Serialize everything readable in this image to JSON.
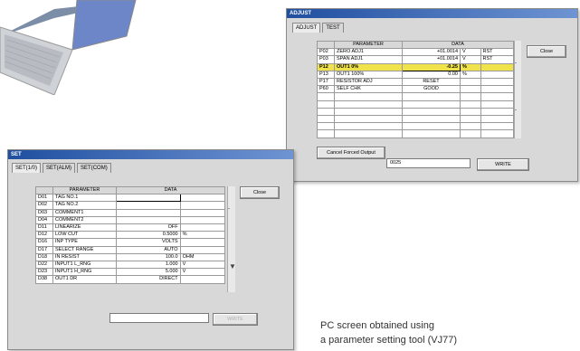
{
  "adjust_window": {
    "title": "ADJUST",
    "tabs": [
      "ADJUST",
      "TEST"
    ],
    "columns": [
      "PARAMETER",
      "DATA"
    ],
    "rows": [
      {
        "code": "P02",
        "name": "ZERO ADJ1",
        "data": "+01.0014",
        "unit": "V",
        "extra": "RST"
      },
      {
        "code": "P03",
        "name": "SPAN ADJ1",
        "data": "+01.0014",
        "unit": "V",
        "extra": "RST"
      },
      {
        "code": "P12",
        "name": "OUT1 0%",
        "data": "-0.25",
        "unit": "%",
        "extra": ""
      },
      {
        "code": "P13",
        "name": "OUT1 100%",
        "data": "0.00",
        "unit": "%",
        "extra": ""
      },
      {
        "code": "P17",
        "name": "RESISTOR ADJ",
        "data": "RESET",
        "unit": "",
        "extra": ""
      },
      {
        "code": "P60",
        "name": "SELF CHK",
        "data": "GOOD",
        "unit": "",
        "extra": ""
      }
    ],
    "close_label": "Close",
    "cancel_button": "Cancel Forced Output",
    "input_value": "0025",
    "write_button": "WRITE"
  },
  "set_window": {
    "title": "SET",
    "tabs": [
      "SET(1/0)",
      "SET(ALM)",
      "SET(COM)"
    ],
    "columns": [
      "PARAMETER",
      "DATA"
    ],
    "rows": [
      {
        "code": "D01",
        "name": "TAG NO.1",
        "data": "",
        "unit": ""
      },
      {
        "code": "D02",
        "name": "TAG NO.2",
        "data": "",
        "unit": ""
      },
      {
        "code": "D03",
        "name": "COMMENT1",
        "data": "",
        "unit": ""
      },
      {
        "code": "D04",
        "name": "COMMENT2",
        "data": "",
        "unit": ""
      },
      {
        "code": "D11",
        "name": "LINEARIZE",
        "data": "OFF",
        "unit": ""
      },
      {
        "code": "D12",
        "name": "LOW CUT",
        "data": "0.5000",
        "unit": "%"
      },
      {
        "code": "D16",
        "name": "INP TYPE",
        "data": "VOLTS",
        "unit": ""
      },
      {
        "code": "D17",
        "name": "SELECT RANGE",
        "data": "AUTO",
        "unit": ""
      },
      {
        "code": "D18",
        "name": "IN RESIST",
        "data": "100.0",
        "unit": "OHM"
      },
      {
        "code": "D22",
        "name": "INPUT1 L_RNG",
        "data": "1.000",
        "unit": "V"
      },
      {
        "code": "D23",
        "name": "INPUT1 H_RNG",
        "data": "5.000",
        "unit": "V"
      },
      {
        "code": "D38",
        "name": "OUT1 DR",
        "data": "DIRECT",
        "unit": ""
      }
    ],
    "close_label": "Close",
    "write_button": "WRITE"
  },
  "caption": {
    "line1": "PC screen obtained using",
    "line2": "a parameter setting tool (VJ77)"
  }
}
